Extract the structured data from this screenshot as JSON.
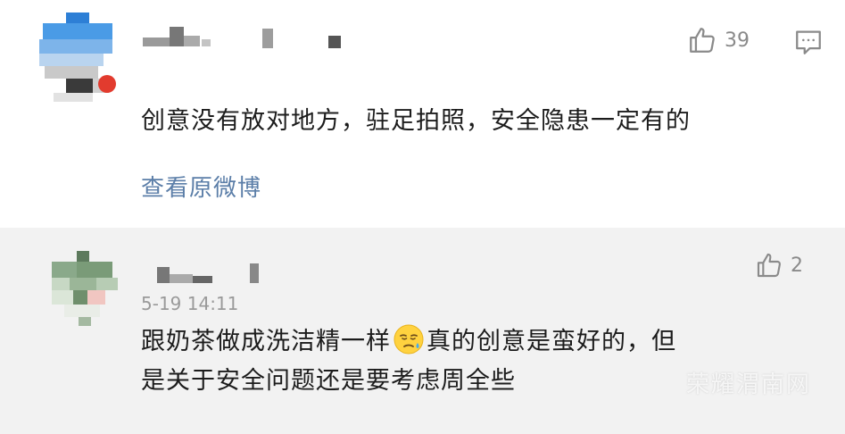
{
  "comments": [
    {
      "like_count": "39",
      "text": "创意没有放对地方，驻足拍照，安全隐患一定有的",
      "view_original": "查看原微博"
    },
    {
      "like_count": "2",
      "timestamp": "5-19 14:11",
      "text_before_emoji": "跟奶茶做成洗洁精一样",
      "text_after_emoji": "真的创意是蛮好的，但",
      "text_line2": "是关于安全问题还是要考虑周全些"
    }
  ],
  "watermark": "荣耀渭南网",
  "icons": {
    "like": "thumbs-up-icon",
    "reply": "comment-reply-icon",
    "emoji": "sweat-face-emoji"
  },
  "colors": {
    "link": "#5b7ea8",
    "muted": "#8a8a8a",
    "reply_background": "#f2f2f2"
  }
}
